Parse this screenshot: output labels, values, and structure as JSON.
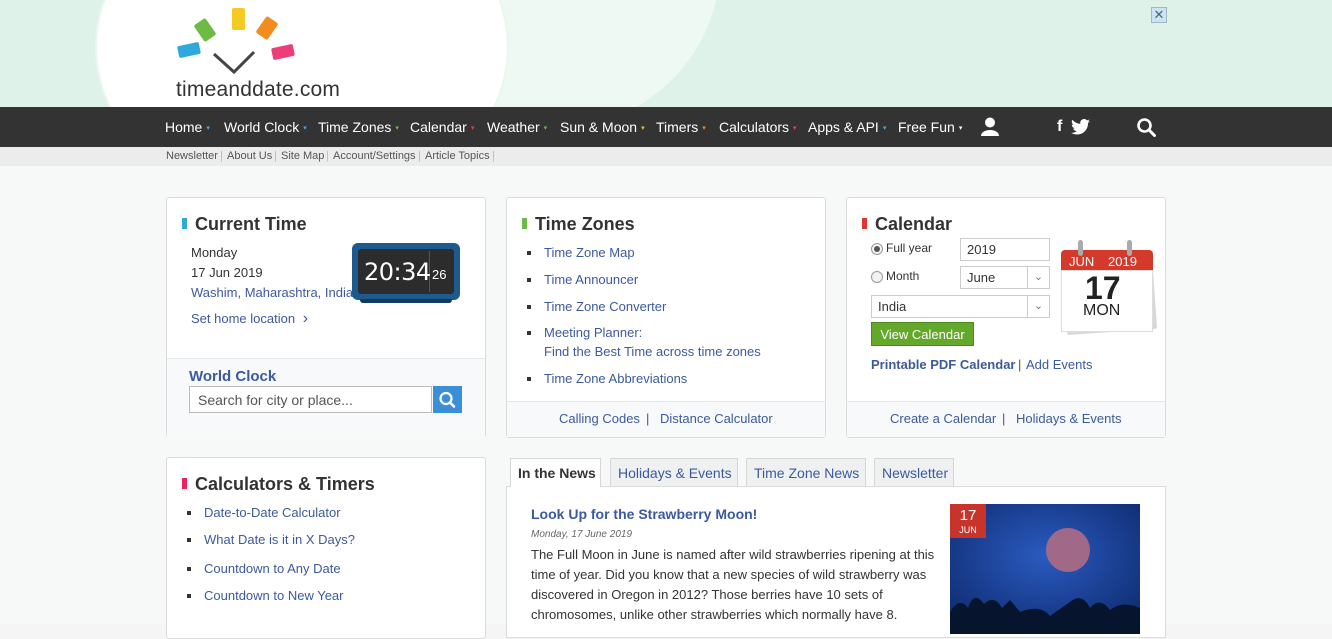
{
  "logo": {
    "wordmark": "timeanddate.com"
  },
  "ad": {
    "close_label": "✕"
  },
  "nav": {
    "items": [
      {
        "label": "Home",
        "caret": "▾"
      },
      {
        "label": "World Clock",
        "caret": "▾"
      },
      {
        "label": "Time Zones",
        "caret": "▾"
      },
      {
        "label": "Calendar",
        "caret": "▾"
      },
      {
        "label": "Weather",
        "caret": "▾"
      },
      {
        "label": "Sun & Moon",
        "caret": "▾"
      },
      {
        "label": "Timers",
        "caret": "▾"
      },
      {
        "label": "Calculators",
        "caret": "▾"
      },
      {
        "label": "Apps & API",
        "caret": "▾"
      },
      {
        "label": "Free Fun",
        "caret": "▾"
      }
    ],
    "social": {
      "facebook": "f"
    }
  },
  "subnav": {
    "items": [
      "Newsletter",
      "About Us",
      "Site Map",
      "Account/Settings",
      "Article Topics"
    ],
    "separator": "|"
  },
  "current_time": {
    "title": "Current Time",
    "weekday": "Monday",
    "date": "17 Jun 2019",
    "location": "Washim, Maharashtra, India",
    "set_home": "Set home location",
    "set_home_chevron": "›",
    "clock_time": "20:34",
    "clock_seconds": "26",
    "world_clock_title": "World Clock",
    "search_placeholder": "Search for city or place..."
  },
  "time_zones": {
    "title": "Time Zones",
    "links": [
      "Time Zone Map",
      "Time Announcer",
      "Time Zone Converter",
      "Meeting Planner:",
      "Find the Best Time across time zones",
      "Time Zone Abbreviations"
    ],
    "footer": {
      "calling_codes": "Calling Codes",
      "separator": "|",
      "distance": "Distance Calculator"
    }
  },
  "calendar": {
    "title": "Calendar",
    "full_year_label": "Full year",
    "month_label": "Month",
    "year_value": "2019",
    "month_value": "June",
    "country_value": "India",
    "arrow": "⌄",
    "view_button": "View Calendar",
    "printable": "Printable PDF Calendar",
    "separator": "|",
    "add_events": "Add Events",
    "icon": {
      "month": "JUN",
      "year": "2019",
      "day": "17",
      "weekday": "MON"
    },
    "footer": {
      "create": "Create a Calendar",
      "separator": "|",
      "holidays": "Holidays & Events"
    }
  },
  "calculators": {
    "title": "Calculators & Timers",
    "links": [
      "Date-to-Date Calculator",
      "What Date is it in X Days?",
      "Countdown to Any Date",
      "Countdown to New Year"
    ]
  },
  "news": {
    "tabs": [
      "In the News",
      "Holidays & Events",
      "Time Zone News",
      "Newsletter"
    ],
    "headline": "Look Up for the Strawberry Moon!",
    "date": "Monday, 17 June 2019",
    "body_lines": [
      "The Full Moon in June is named after wild strawberries ripening at this",
      "time of year. Did you know that a new species of wild strawberry was",
      "discovered in Oregon in 2012? Those berries have 10 sets of",
      "chromosomes, unlike other strawberries which normally have 8."
    ],
    "badge": {
      "day": "17",
      "month": "JUN"
    }
  },
  "colors": {
    "nav_bg": "#333333",
    "link": "#3b5a9d",
    "accent_blue": "#30a7dd",
    "accent_green": "#6dbb45",
    "accent_red": "#e3342f",
    "accent_pink": "#e8235f",
    "button_green": "#63a82b"
  }
}
